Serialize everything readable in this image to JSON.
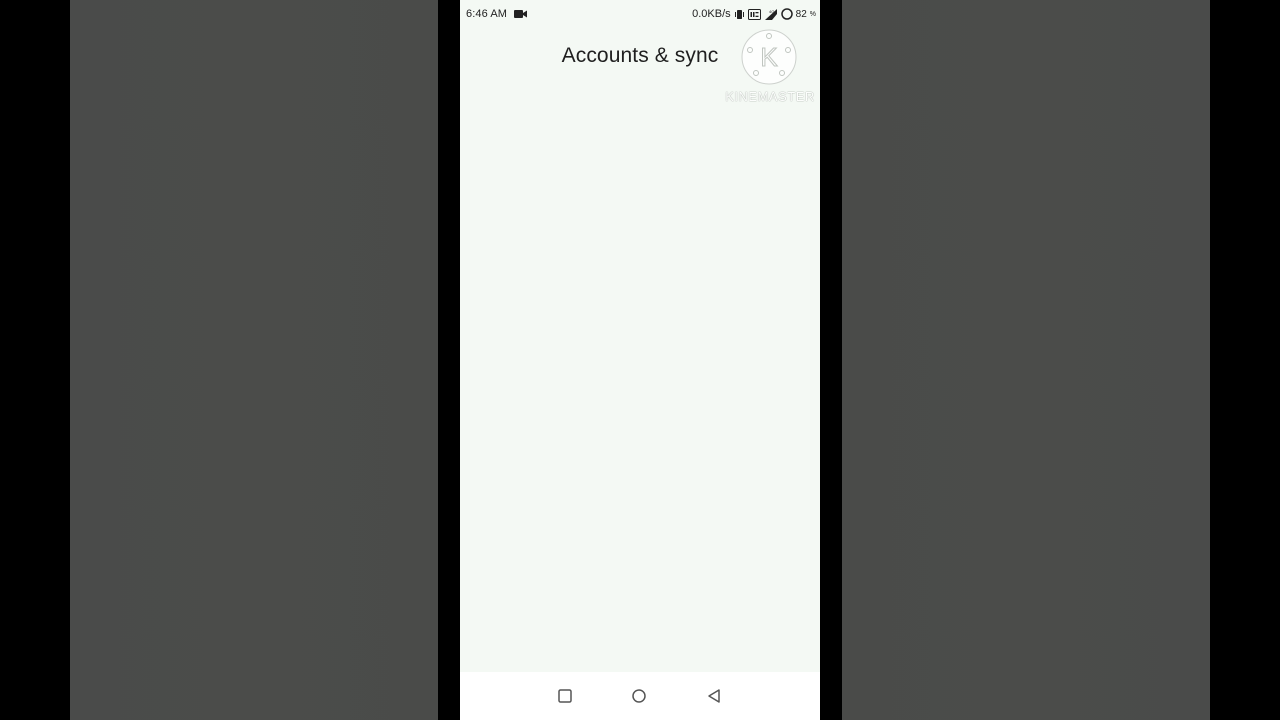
{
  "status_bar": {
    "time": "6:46 AM",
    "network_speed": "0.0KB/s",
    "battery": "82",
    "icons": [
      "video-camera-icon",
      "vibrate-icon",
      "volte-icon",
      "signal-icon",
      "battery-ring-icon"
    ]
  },
  "page": {
    "title": "Accounts & sync"
  },
  "watermark": {
    "text": "KINEMASTER",
    "logo_letter": "K"
  },
  "nav_bar": {
    "buttons": [
      "recents-icon",
      "home-icon",
      "back-icon"
    ]
  },
  "colors": {
    "screen_bg": "#f4f9f4",
    "side_bg": "#4b4c4a",
    "outer_bg": "#000000",
    "nav_bg": "#ffffff"
  }
}
